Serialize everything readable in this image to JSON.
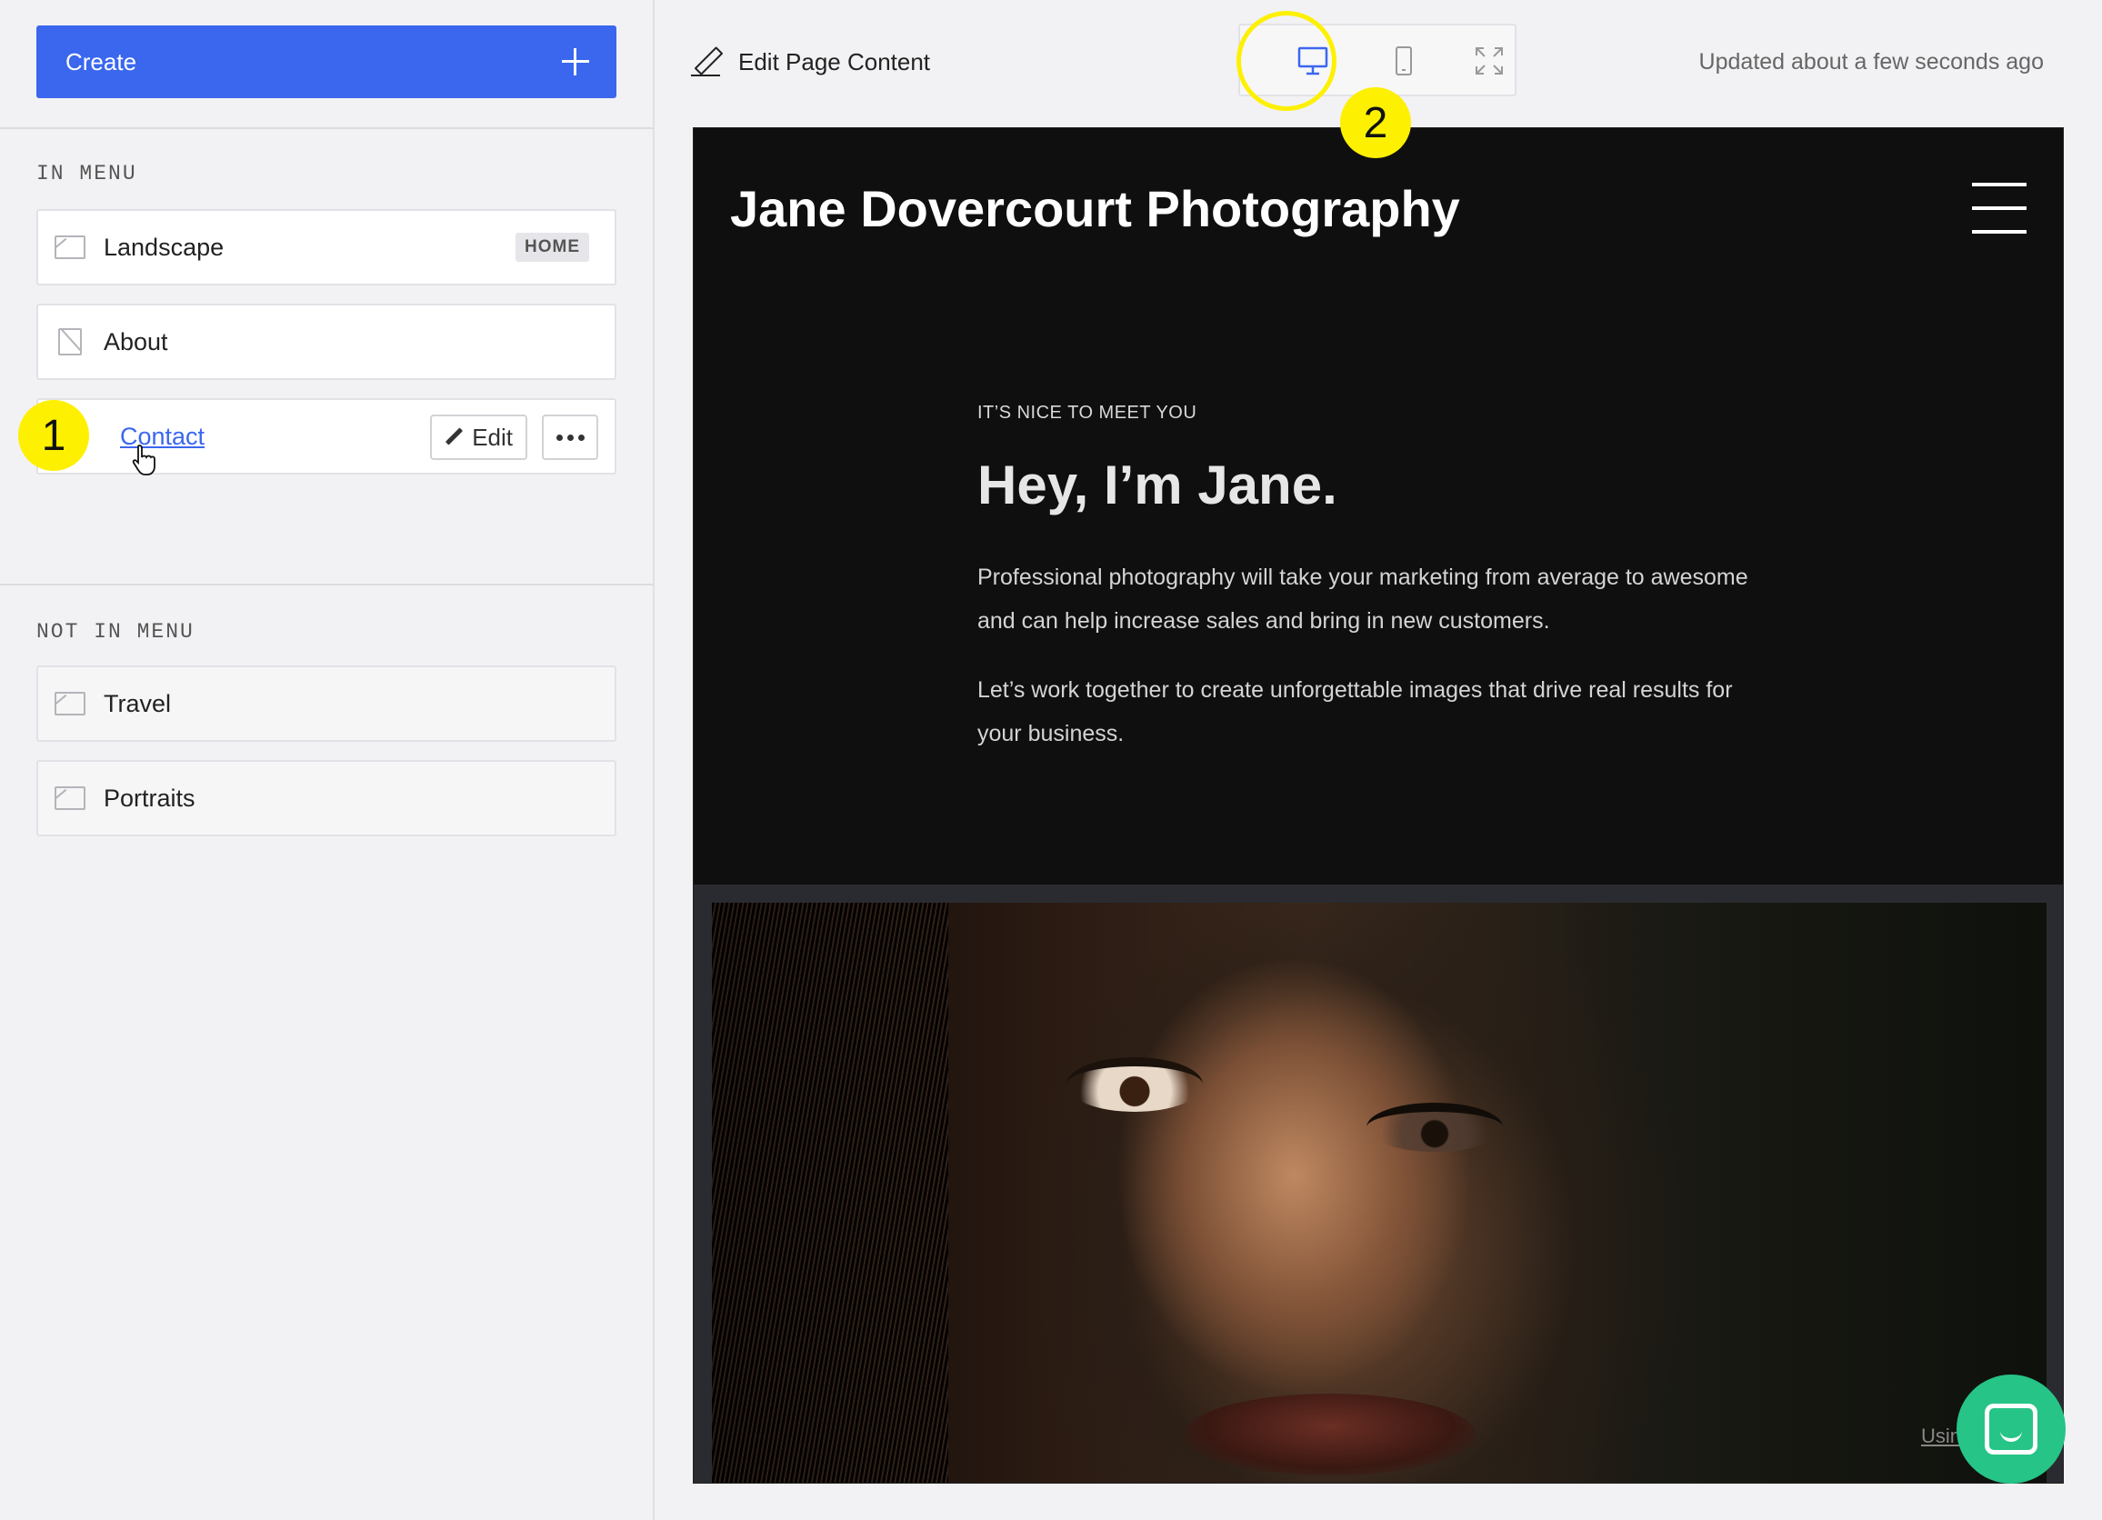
{
  "sidebar": {
    "create_label": "Create",
    "in_menu_label": "IN MENU",
    "not_in_menu_label": "NOT IN MENU",
    "in_menu_items": [
      {
        "label": "Landscape",
        "badge": "HOME",
        "icon": "image-icon"
      },
      {
        "label": "About",
        "icon": "no-image-icon"
      },
      {
        "label": "Contact",
        "edit_label": "Edit"
      }
    ],
    "not_in_menu_items": [
      {
        "label": "Travel",
        "icon": "image-icon"
      },
      {
        "label": "Portraits",
        "icon": "image-icon"
      }
    ]
  },
  "markers": {
    "one": "1",
    "two": "2"
  },
  "topbar": {
    "edit_page_label": "Edit Page Content",
    "updated_text": "Updated about a few seconds ago",
    "views": [
      "desktop-icon",
      "mobile-icon",
      "fullscreen-icon"
    ]
  },
  "preview": {
    "site_title": "Jane Dovercourt Photography",
    "eyebrow": "IT’S NICE TO MEET YOU",
    "heading": "Hey, I’m Jane.",
    "paragraph_1": "Professional photography will take your marketing from average to awesome and can help increase sales and bring in new customers.",
    "paragraph_2": "Let’s work together to create unforgettable images that drive real results for your business.",
    "photo_credit": "Using"
  },
  "colors": {
    "accent": "#3a67ee",
    "marker": "#fdf000",
    "chat": "#26c486",
    "preview_bg": "#0f0f10"
  }
}
